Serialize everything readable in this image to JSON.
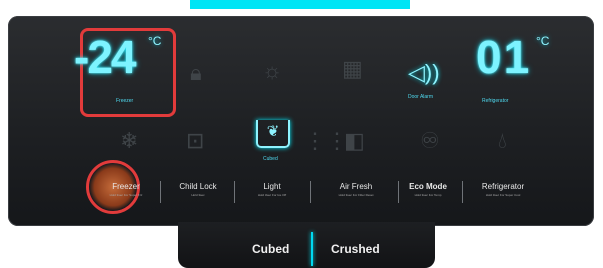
{
  "banner": {
    "color": "#00e5f5"
  },
  "freezer_display": {
    "temperature": "-24",
    "unit": "°C",
    "label": "Freezer",
    "highlight_color": "#e23b3b"
  },
  "refrigerator_display": {
    "temperature": "01",
    "unit": "°C",
    "label": "Refrigerator"
  },
  "door_alarm": {
    "label": "Door Alarm"
  },
  "ice_mode_indicator": {
    "label": "Cubed"
  },
  "buttons": [
    {
      "label": "Freezer",
      "sub": "Hold 3sec For Super Frz"
    },
    {
      "label": "Child Lock",
      "sub": "Hold 3sec"
    },
    {
      "label": "Light",
      "sub": "Hold 3sec For Ice Off"
    },
    {
      "label": "Air Fresh",
      "sub": "Hold 3sec For Filter Reset"
    },
    {
      "label": "Eco Mode",
      "sub": "Hold 3sec For Temp"
    },
    {
      "label": "Refrigerator",
      "sub": "Hold 3sec For Super Cool"
    }
  ],
  "ice_modes": [
    {
      "label": "Cubed"
    },
    {
      "label": "Crushed"
    }
  ]
}
